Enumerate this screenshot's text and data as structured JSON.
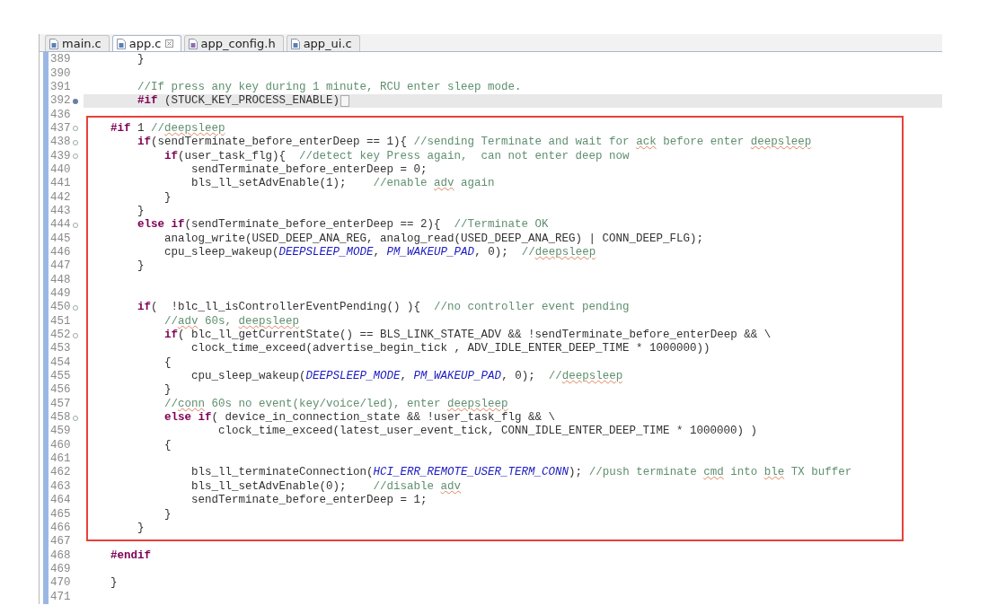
{
  "tabs": [
    {
      "label": "main.c",
      "kind": "source",
      "selected": false
    },
    {
      "label": "app.c",
      "kind": "source",
      "selected": true
    },
    {
      "label": "app_config.h",
      "kind": "header",
      "selected": false
    },
    {
      "label": "app_ui.c",
      "kind": "source",
      "selected": false
    }
  ],
  "lines": [
    {
      "number": "389",
      "tokens": [
        {
          "kind": "tx",
          "text": "        }"
        }
      ]
    },
    {
      "number": "390"
    },
    {
      "number": "391",
      "tokens": [
        {
          "kind": "cm",
          "text": "        //If press any key during 1 minute, RCU enter sleep mode."
        }
      ]
    },
    {
      "number": "392",
      "collapsed": true,
      "current": true,
      "tokens": [
        {
          "kind": "kw",
          "text": "        #if"
        },
        {
          "kind": "tx",
          "text": " (STUCK_KEY_PROCESS_ENABLE)"
        }
      ]
    },
    {
      "number": "436"
    },
    {
      "number": "437",
      "collapsed": false,
      "tokens": [
        {
          "kind": "kw",
          "text": "    #if"
        },
        {
          "kind": "tx",
          "text": " 1 "
        },
        {
          "kind": "cm",
          "text": "//"
        },
        {
          "kind": "cm",
          "text": "deepsleep",
          "misspelled": true
        }
      ]
    },
    {
      "number": "438",
      "collapsed": false,
      "tokens": [
        {
          "kind": "kw",
          "text": "        if"
        },
        {
          "kind": "tx",
          "text": "(sendTerminate_before_enterDeep == 1){ "
        },
        {
          "kind": "cm",
          "text": "//sending Terminate and wait for "
        },
        {
          "kind": "cm",
          "text": "ack",
          "misspelled": true
        },
        {
          "kind": "cm",
          "text": " before enter "
        },
        {
          "kind": "cm",
          "text": "deepsleep",
          "misspelled": true
        }
      ]
    },
    {
      "number": "439",
      "collapsed": false,
      "tokens": [
        {
          "kind": "kw",
          "text": "            if"
        },
        {
          "kind": "tx",
          "text": "(user_task_flg){  "
        },
        {
          "kind": "cm",
          "text": "//detect key Press again,  can not enter deep now"
        }
      ]
    },
    {
      "number": "440",
      "tokens": [
        {
          "kind": "tx",
          "text": "                sendTerminate_before_enterDeep = 0;"
        }
      ]
    },
    {
      "number": "441",
      "tokens": [
        {
          "kind": "tx",
          "text": "                bls_ll_setAdvEnable(1);    "
        },
        {
          "kind": "cm",
          "text": "//enable "
        },
        {
          "kind": "cm",
          "text": "adv",
          "misspelled": true
        },
        {
          "kind": "cm",
          "text": " again"
        }
      ]
    },
    {
      "number": "442",
      "tokens": [
        {
          "kind": "tx",
          "text": "            }"
        }
      ]
    },
    {
      "number": "443",
      "tokens": [
        {
          "kind": "tx",
          "text": "        }"
        }
      ]
    },
    {
      "number": "444",
      "collapsed": false,
      "tokens": [
        {
          "kind": "kw",
          "text": "        else if"
        },
        {
          "kind": "tx",
          "text": "(sendTerminate_before_enterDeep == 2){  "
        },
        {
          "kind": "cm",
          "text": "//Terminate OK"
        }
      ]
    },
    {
      "number": "445",
      "tokens": [
        {
          "kind": "tx",
          "text": "            analog_write(USED_DEEP_ANA_REG, analog_read(USED_DEEP_ANA_REG) | CONN_DEEP_FLG);"
        }
      ]
    },
    {
      "number": "446",
      "tokens": [
        {
          "kind": "tx",
          "text": "            cpu_sleep_wakeup("
        },
        {
          "kind": "mac",
          "text": "DEEPSLEEP_MODE"
        },
        {
          "kind": "tx",
          "text": ", "
        },
        {
          "kind": "mac",
          "text": "PM_WAKEUP_PAD"
        },
        {
          "kind": "tx",
          "text": ", 0);  "
        },
        {
          "kind": "cm",
          "text": "//"
        },
        {
          "kind": "cm",
          "text": "deepsleep",
          "misspelled": true
        }
      ]
    },
    {
      "number": "447",
      "tokens": [
        {
          "kind": "tx",
          "text": "        }"
        }
      ]
    },
    {
      "number": "448"
    },
    {
      "number": "449"
    },
    {
      "number": "450",
      "collapsed": false,
      "tokens": [
        {
          "kind": "kw",
          "text": "        if"
        },
        {
          "kind": "tx",
          "text": "(  !blc_ll_isControllerEventPending() ){  "
        },
        {
          "kind": "cm",
          "text": "//no controller event pending"
        }
      ]
    },
    {
      "number": "451",
      "tokens": [
        {
          "kind": "cm",
          "text": "            //"
        },
        {
          "kind": "cm",
          "text": "adv",
          "misspelled": true
        },
        {
          "kind": "cm",
          "text": " 60s, "
        },
        {
          "kind": "cm",
          "text": "deepsleep",
          "misspelled": true
        }
      ]
    },
    {
      "number": "452",
      "collapsed": false,
      "tokens": [
        {
          "kind": "kw",
          "text": "            if"
        },
        {
          "kind": "tx",
          "text": "( blc_ll_getCurrentState() == BLS_LINK_STATE_ADV && !sendTerminate_before_enterDeep && \\"
        }
      ]
    },
    {
      "number": "453",
      "tokens": [
        {
          "kind": "tx",
          "text": "                clock_time_exceed(advertise_begin_tick , ADV_IDLE_ENTER_DEEP_TIME * 1000000))"
        }
      ]
    },
    {
      "number": "454",
      "tokens": [
        {
          "kind": "tx",
          "text": "            {"
        }
      ]
    },
    {
      "number": "455",
      "tokens": [
        {
          "kind": "tx",
          "text": "                cpu_sleep_wakeup("
        },
        {
          "kind": "mac",
          "text": "DEEPSLEEP_MODE"
        },
        {
          "kind": "tx",
          "text": ", "
        },
        {
          "kind": "mac",
          "text": "PM_WAKEUP_PAD"
        },
        {
          "kind": "tx",
          "text": ", 0);  "
        },
        {
          "kind": "cm",
          "text": "//"
        },
        {
          "kind": "cm",
          "text": "deepsleep",
          "misspelled": true
        }
      ]
    },
    {
      "number": "456",
      "tokens": [
        {
          "kind": "tx",
          "text": "            }"
        }
      ]
    },
    {
      "number": "457",
      "tokens": [
        {
          "kind": "cm",
          "text": "            //"
        },
        {
          "kind": "cm",
          "text": "conn",
          "misspelled": true
        },
        {
          "kind": "cm",
          "text": " 60s no event(key/voice/led), enter "
        },
        {
          "kind": "cm",
          "text": "deepsleep",
          "misspelled": true
        }
      ]
    },
    {
      "number": "458",
      "collapsed": false,
      "tokens": [
        {
          "kind": "kw",
          "text": "            else if"
        },
        {
          "kind": "tx",
          "text": "( device_in_connection_state && !user_task_flg && \\"
        }
      ]
    },
    {
      "number": "459",
      "tokens": [
        {
          "kind": "tx",
          "text": "                    clock_time_exceed(latest_user_event_tick, CONN_IDLE_ENTER_DEEP_TIME * 1000000) )"
        }
      ]
    },
    {
      "number": "460",
      "tokens": [
        {
          "kind": "tx",
          "text": "            {"
        }
      ]
    },
    {
      "number": "461"
    },
    {
      "number": "462",
      "tokens": [
        {
          "kind": "tx",
          "text": "                bls_ll_terminateConnection("
        },
        {
          "kind": "mac",
          "text": "HCI_ERR_REMOTE_USER_TERM_CONN"
        },
        {
          "kind": "tx",
          "text": "); "
        },
        {
          "kind": "cm",
          "text": "//push terminate "
        },
        {
          "kind": "cm",
          "text": "cmd",
          "misspelled": true
        },
        {
          "kind": "cm",
          "text": " into "
        },
        {
          "kind": "cm",
          "text": "ble",
          "misspelled": true
        },
        {
          "kind": "cm",
          "text": " TX buffer"
        }
      ]
    },
    {
      "number": "463",
      "tokens": [
        {
          "kind": "tx",
          "text": "                bls_ll_setAdvEnable(0);    "
        },
        {
          "kind": "cm",
          "text": "//disable "
        },
        {
          "kind": "cm",
          "text": "adv",
          "misspelled": true
        }
      ]
    },
    {
      "number": "464",
      "tokens": [
        {
          "kind": "tx",
          "text": "                sendTerminate_before_enterDeep = 1;"
        }
      ]
    },
    {
      "number": "465",
      "tokens": [
        {
          "kind": "tx",
          "text": "            }"
        }
      ]
    },
    {
      "number": "466",
      "tokens": [
        {
          "kind": "tx",
          "text": "        }"
        }
      ]
    },
    {
      "number": "467"
    },
    {
      "number": "468",
      "tokens": [
        {
          "kind": "kw",
          "text": "    #endif"
        }
      ]
    },
    {
      "number": "469"
    },
    {
      "number": "470",
      "tokens": [
        {
          "kind": "tx",
          "text": "    }"
        }
      ]
    },
    {
      "number": "471"
    }
  ]
}
